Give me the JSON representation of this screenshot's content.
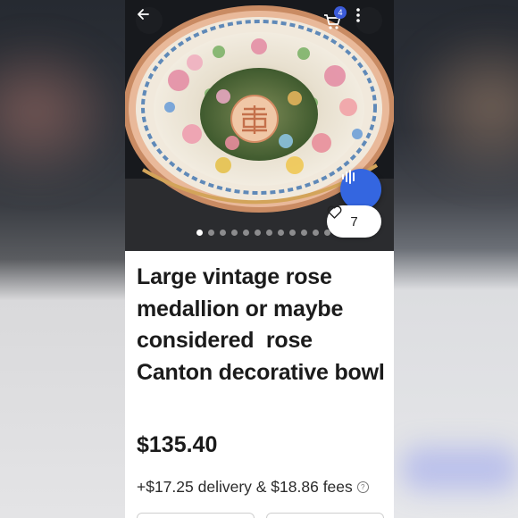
{
  "header": {
    "cart_count": "4"
  },
  "icons": {
    "back": "arrow-left-icon",
    "cart": "cart-icon",
    "more": "more-vertical-icon",
    "voice": "audio-waveform-icon",
    "like": "heart-icon",
    "info": "info-icon"
  },
  "gallery": {
    "image_count": 12,
    "active_index": 0
  },
  "listing": {
    "like_count": "7",
    "title": "Large vintage rose medallion or maybe considered  rose Canton decorative bowl",
    "price": "$135.40",
    "fees": "+$17.25 delivery & $18.86 fees"
  },
  "colors": {
    "accent": "#3466e0",
    "badge": "#3b5bd9",
    "text": "#1b1b1b"
  }
}
